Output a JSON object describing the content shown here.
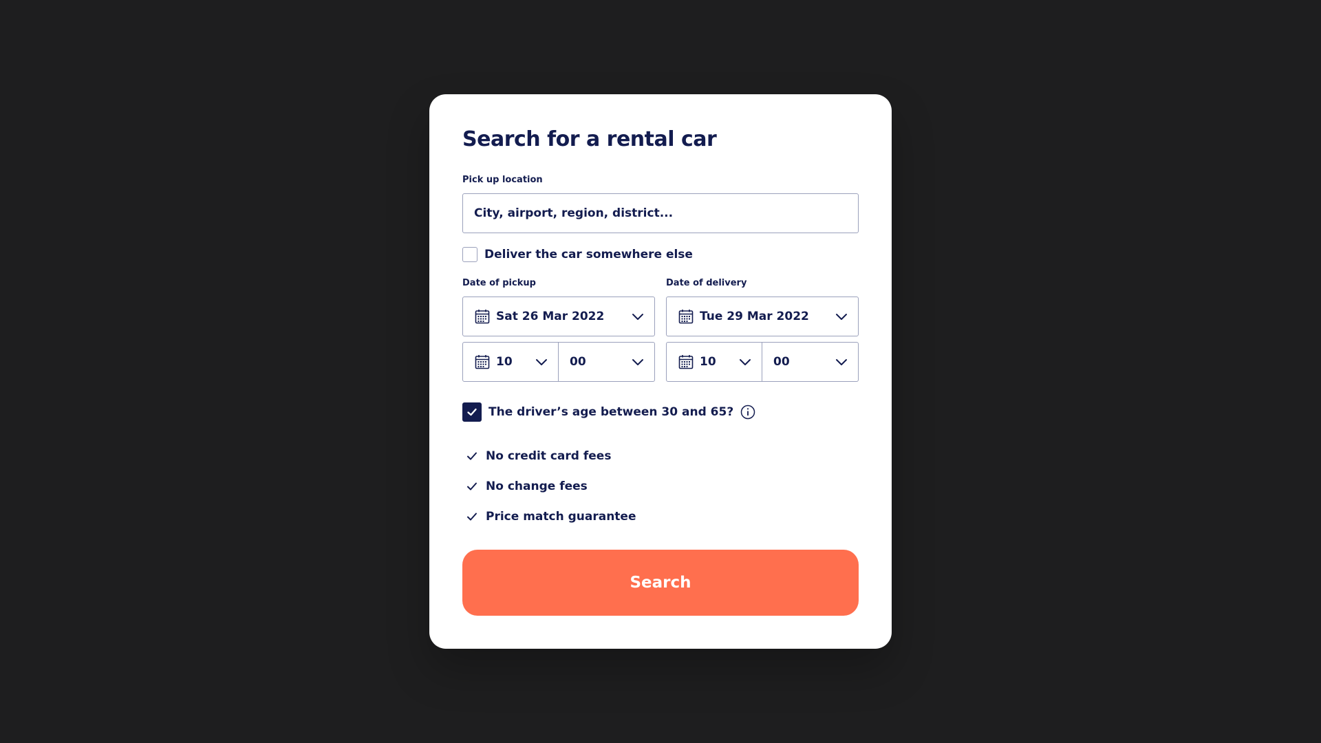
{
  "form": {
    "title": "Search for a rental car",
    "pickup_location": {
      "label": "Pick up location",
      "placeholder": "City, airport, region, district...",
      "value": ""
    },
    "deliver_elsewhere": {
      "label": "Deliver the car somewhere else",
      "checked": false
    },
    "pickup_date": {
      "label": "Date of pickup",
      "date": "Sat 26 Mar 2022",
      "hour": "10",
      "minute": "00"
    },
    "delivery_date": {
      "label": "Date of delivery",
      "date": "Tue 29 Mar 2022",
      "hour": "10",
      "minute": "00"
    },
    "driver_age": {
      "label": "The driver’s age between 30 and 65?",
      "checked": true
    },
    "features": [
      "No credit card fees",
      "No change fees",
      "Price match guarantee"
    ],
    "search_label": "Search"
  },
  "colors": {
    "background": "#1e1e1f",
    "card": "#ffffff",
    "text": "#131c4f",
    "border": "#9aa0bb",
    "accent": "#ff6f4e"
  },
  "icons": {
    "date": "calendar-icon",
    "dropdown": "chevron-down-icon",
    "info": "info-icon",
    "feature": "check-icon"
  }
}
